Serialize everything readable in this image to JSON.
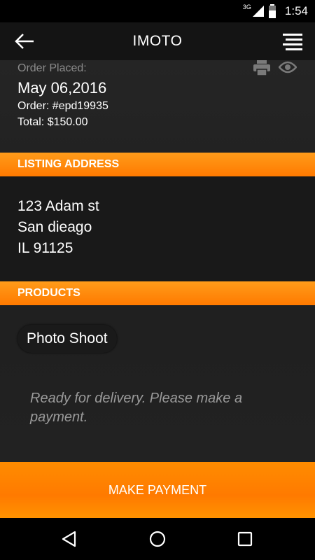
{
  "status_bar": {
    "network": "3G",
    "time": "1:54"
  },
  "header": {
    "title": "IMOTO",
    "back_icon": "back-arrow-icon",
    "menu_icon": "menu-icon"
  },
  "order": {
    "placed_label": "Order Placed:",
    "date": "May 06,2016",
    "number": "Order: #epd19935",
    "total": "Total: $150.00"
  },
  "actions": {
    "print_icon": "print-icon",
    "view_icon": "eye-icon"
  },
  "listing_address": {
    "header": "LISTING ADDRESS",
    "lines": [
      "123 Adam st",
      "San dieago",
      "IL 91125"
    ]
  },
  "products": {
    "header": "PRODUCTS",
    "items": [
      "Photo Shoot"
    ],
    "note": "Ready for delivery. Please make a payment."
  },
  "payment": {
    "button_label": "MAKE PAYMENT"
  },
  "colors": {
    "accent": "#ff7a00",
    "background": "#1c1c1c",
    "muted_text": "#9a9a9a"
  }
}
